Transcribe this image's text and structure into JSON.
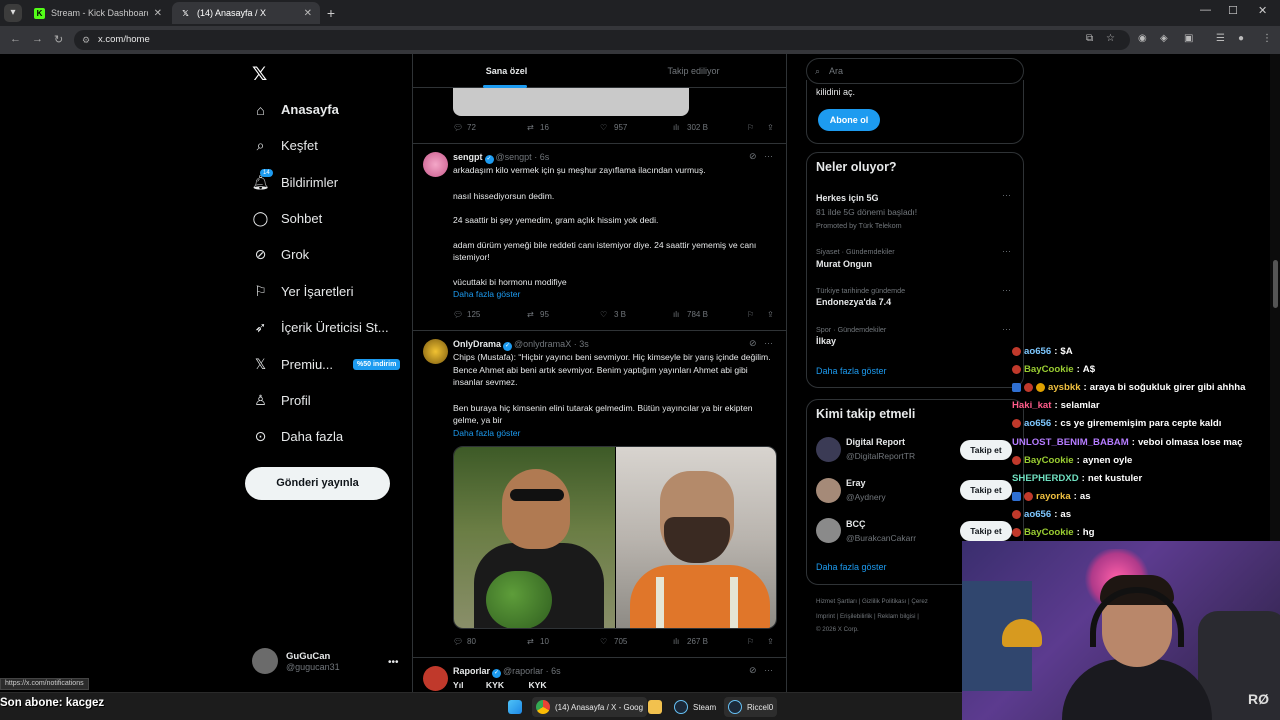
{
  "browser": {
    "tabs": [
      {
        "label": "Stream - Kick Dashboard",
        "icon": "kick-icon"
      },
      {
        "label": "(14) Anasayfa / X",
        "icon": "x-icon"
      }
    ],
    "url": "x.com/home",
    "status_url": "https://x.com/notifications"
  },
  "nav": {
    "items": [
      {
        "label": "Anasayfa",
        "icon": "home-icon"
      },
      {
        "label": "Keşfet",
        "icon": "search-icon"
      },
      {
        "label": "Bildirimler",
        "icon": "bell-icon",
        "badge": "14"
      },
      {
        "label": "Sohbet",
        "icon": "chat-icon"
      },
      {
        "label": "Grok",
        "icon": "grok-icon"
      },
      {
        "label": "Yer İşaretleri",
        "icon": "bookmark-icon"
      },
      {
        "label": "İçerik Üreticisi St...",
        "icon": "rocket-icon"
      },
      {
        "label": "Premiu...",
        "icon": "x-icon",
        "promo": "%50 indirim"
      },
      {
        "label": "Profil",
        "icon": "person-icon"
      },
      {
        "label": "Daha fazla",
        "icon": "more-circle-icon"
      }
    ],
    "post_button": "Gönderi yayınla",
    "profile": {
      "name": "GuGuCan",
      "handle": "@gugucan31"
    }
  },
  "feed": {
    "tabs": [
      "Sana özel",
      "Takip ediliyor"
    ],
    "prev_actions": {
      "replies": "72",
      "reposts": "16",
      "likes": "957",
      "views": "302 B"
    },
    "tweets": [
      {
        "name": "sengpt",
        "handle": "@sengpt",
        "time": "6s",
        "lines": [
          "arkadaşım kilo vermek için şu meşhur zayıflama ilacından vurmuş.",
          "nasıl hissediyorsun dedim.",
          "24 saattir bi şey yemedim, gram açlık hissim yok dedi.",
          "adam dürüm yemeği bile reddeti canı istemiyor diye. 24 saattir yememiş ve canı istemiyor!",
          "vücuttaki bi hormonu modifiye"
        ],
        "more": "Daha fazla göster",
        "actions": {
          "replies": "125",
          "reposts": "95",
          "likes": "3 B",
          "views": "784 B"
        }
      },
      {
        "name": "OnlyDrama",
        "handle": "@onlydramaX",
        "time": "3s",
        "lines": [
          "Chips (Mustafa): “Hiçbir yayıncı beni sevmiyor. Hiç kimseyle bir yarış içinde değilim. Bence Ahmet abi beni artık sevmiyor. Benim yaptığım yayınları Ahmet abi gibi insanlar sevmez.",
          "Ben buraya hiç kimsenin elini tutarak gelmedim. Bütün yayıncılar ya bir ekipten gelme, ya bir"
        ],
        "more": "Daha fazla göster",
        "actions": {
          "replies": "80",
          "reposts": "10",
          "likes": "705",
          "views": "267 B"
        }
      },
      {
        "name": "Raporlar",
        "handle": "@raporlar",
        "time": "6s",
        "cols": [
          "Yıl",
          "KYK",
          "KYK"
        ]
      }
    ]
  },
  "right": {
    "search_placeholder": "Ara",
    "subscribe_text": "kilidini aç.",
    "subscribe_button": "Abone ol",
    "trending_title": "Neler oluyor?",
    "trends": [
      {
        "title": "Herkes için 5G",
        "desc": "81 ilde 5G dönemi başladı!",
        "meta": "Promoted by Türk Telekom"
      },
      {
        "meta": "Siyaset · Gündemdekiler",
        "title": "Murat Ongun"
      },
      {
        "meta": "Türkiye tarihinde gündemde",
        "title": "Endonezya'da 7.4"
      },
      {
        "meta": "Spor · Gündemdekiler",
        "title": "İlkay"
      }
    ],
    "show_more": "Daha fazla göster",
    "who_to_follow_title": "Kimi takip etmeli",
    "suggestions": [
      {
        "name": "Digital Report",
        "handle": "@DigitalReportTR",
        "button": "Takip et"
      },
      {
        "name": "Eray",
        "handle": "@Aydnery",
        "button": "Takip et"
      },
      {
        "name": "BCÇ",
        "handle": "@BurakcanCakarr",
        "button": "Takip et"
      }
    ],
    "footer_line1": "Hizmet Şartları  |  Gizlilik Politikası  |  Çerez",
    "footer_line2": "Imprint  |  Erişilebilirlik  |  Reklam bilgisi  |",
    "footer_line3": "© 2026 X Corp."
  },
  "chat": [
    {
      "user": "ao656",
      "msg": "$A",
      "color": "#7ec8ff",
      "badges": [
        "red"
      ]
    },
    {
      "user": "BayCookie",
      "msg": "A$",
      "color": "#9acd32",
      "badges": [
        "red"
      ]
    },
    {
      "user": "aysbkk",
      "msg": "araya bi soğukluk girer gibi ahhha",
      "color": "#f0c040",
      "badges": [
        "blue",
        "red",
        "gold"
      ]
    },
    {
      "user": "Haki_kat",
      "msg": "selamlar",
      "color": "#ff5c8a",
      "badges": []
    },
    {
      "user": "ao656",
      "msg": "cs ye girememişim para cepte kaldı",
      "color": "#7ec8ff",
      "badges": [
        "red"
      ]
    },
    {
      "user": "UNLOST_BENIM_BABAM",
      "msg": "veboi olmasa lose maç",
      "color": "#b57cff",
      "badges": []
    },
    {
      "user": "BayCookie",
      "msg": "aynen oyle",
      "color": "#9acd32",
      "badges": [
        "red"
      ]
    },
    {
      "user": "SHEPHERDXD",
      "msg": "net kustuler",
      "color": "#6fe0c0",
      "badges": []
    },
    {
      "user": "rayorka",
      "msg": "as",
      "color": "#f0c040",
      "badges": [
        "blue",
        "red"
      ]
    },
    {
      "user": "ao656",
      "msg": "as",
      "color": "#7ec8ff",
      "badges": [
        "red"
      ]
    },
    {
      "user": "BayCookie",
      "msg": "hg",
      "color": "#9acd32",
      "badges": [
        "red"
      ]
    }
  ],
  "stream": {
    "last_sub": "Son abone: kacgez",
    "chair_text": "RØ"
  },
  "taskbar": {
    "items": [
      {
        "label": "(14) Anasayfa / X - Goog",
        "icon": "chrome-icon"
      },
      {
        "label": "",
        "icon": "folder-icon"
      },
      {
        "label": "Steam",
        "icon": "steam-icon"
      },
      {
        "label": "Riccel0",
        "icon": "steam-icon"
      }
    ]
  }
}
